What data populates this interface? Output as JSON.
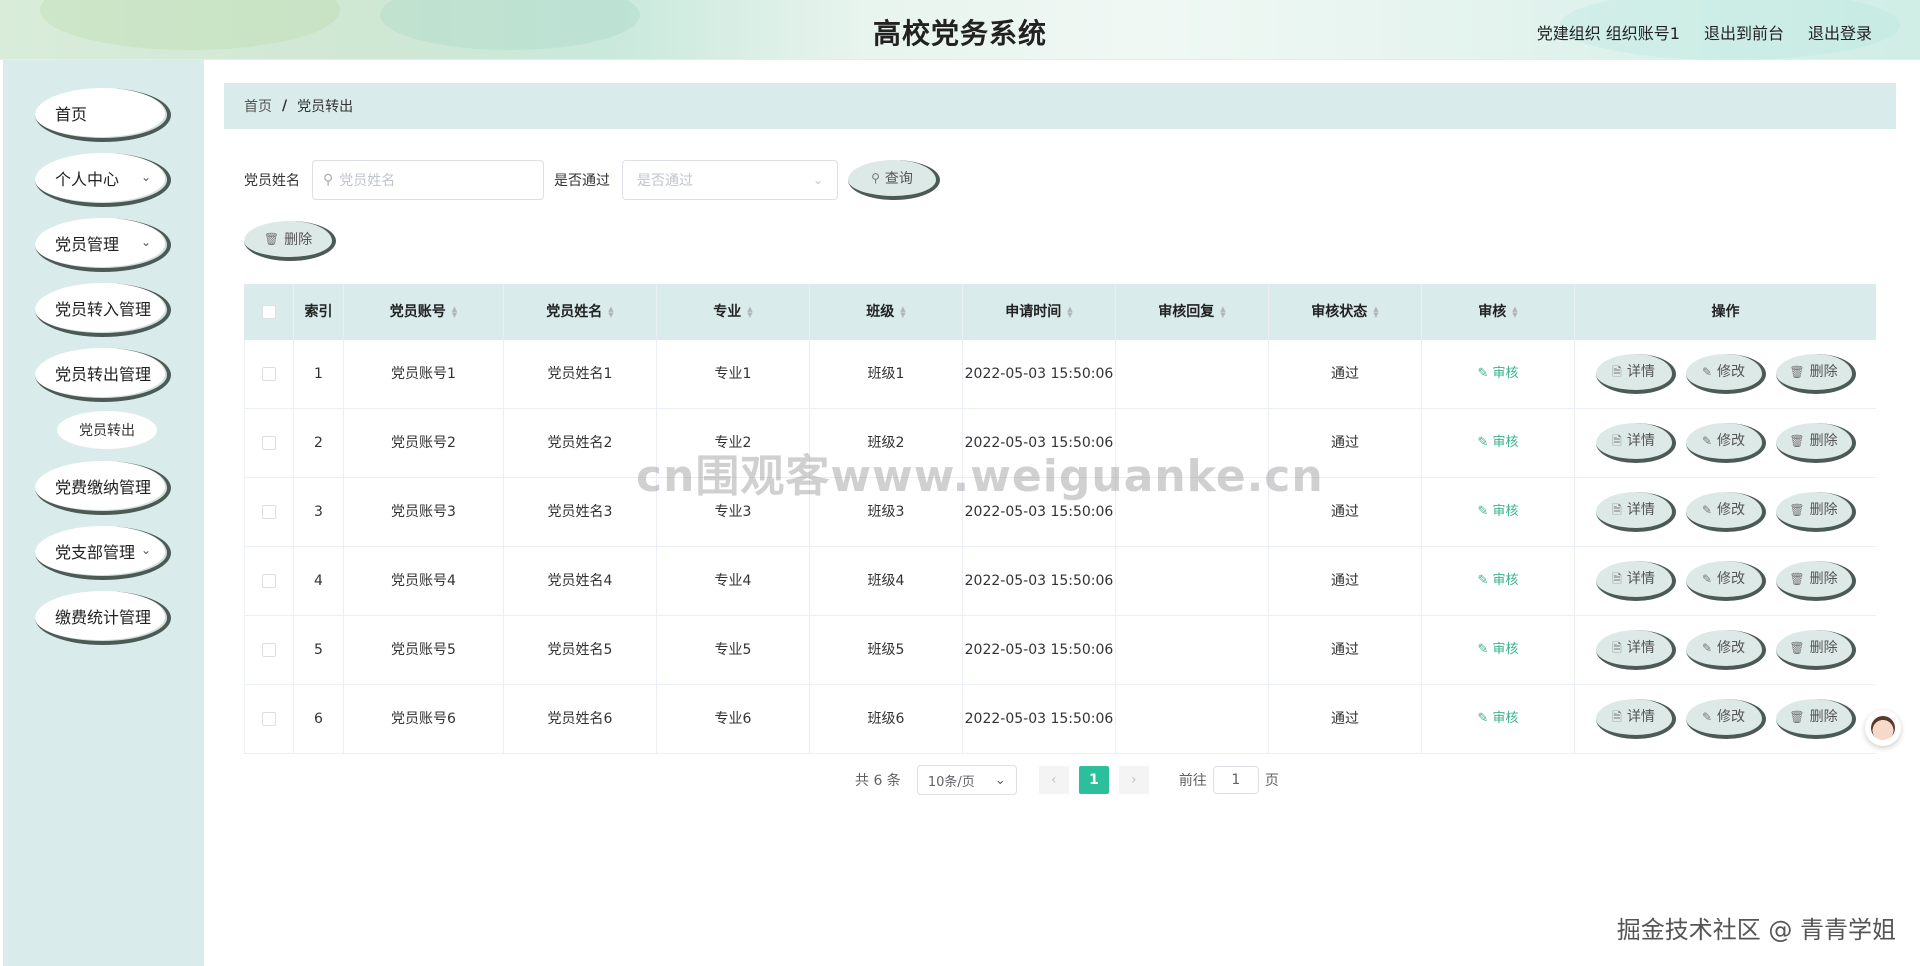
{
  "header": {
    "title": "高校党务系统",
    "user": "党建组织 组织账号1",
    "to_front": "退出到前台",
    "logout": "退出登录"
  },
  "sidebar": {
    "items": [
      {
        "label": "首页",
        "has_arrow": false
      },
      {
        "label": "个人中心",
        "has_arrow": true
      },
      {
        "label": "党员管理",
        "has_arrow": true
      },
      {
        "label": "党员转入管理",
        "has_arrow": false
      },
      {
        "label": "党员转出管理",
        "has_arrow": false
      },
      {
        "label": "党费缴纳管理",
        "has_arrow": false
      },
      {
        "label": "党支部管理",
        "has_arrow": true
      },
      {
        "label": "缴费统计管理",
        "has_arrow": false
      }
    ],
    "subitem": "党员转出"
  },
  "breadcrumb": {
    "home": "首页",
    "separator": "/",
    "current": "党员转出"
  },
  "search": {
    "name_label": "党员姓名",
    "name_placeholder": "党员姓名",
    "pass_label": "是否通过",
    "pass_placeholder": "是否通过",
    "query_button": "查询",
    "delete_button": "删除"
  },
  "table": {
    "headers": [
      "索引",
      "党员账号",
      "党员姓名",
      "专业",
      "班级",
      "申请时间",
      "审核回复",
      "审核状态",
      "审核",
      "操作"
    ],
    "rows": [
      {
        "index": "1",
        "account": "党员账号1",
        "name": "党员姓名1",
        "major": "专业1",
        "class": "班级1",
        "time": "2022-05-03 15:50:06",
        "reply": "",
        "status": "通过"
      },
      {
        "index": "2",
        "account": "党员账号2",
        "name": "党员姓名2",
        "major": "专业2",
        "class": "班级2",
        "time": "2022-05-03 15:50:06",
        "reply": "",
        "status": "通过"
      },
      {
        "index": "3",
        "account": "党员账号3",
        "name": "党员姓名3",
        "major": "专业3",
        "class": "班级3",
        "time": "2022-05-03 15:50:06",
        "reply": "",
        "status": "通过"
      },
      {
        "index": "4",
        "account": "党员账号4",
        "name": "党员姓名4",
        "major": "专业4",
        "class": "班级4",
        "time": "2022-05-03 15:50:06",
        "reply": "",
        "status": "通过"
      },
      {
        "index": "5",
        "account": "党员账号5",
        "name": "党员姓名5",
        "major": "专业5",
        "class": "班级5",
        "time": "2022-05-03 15:50:06",
        "reply": "",
        "status": "通过"
      },
      {
        "index": "6",
        "account": "党员账号6",
        "name": "党员姓名6",
        "major": "专业6",
        "class": "班级6",
        "time": "2022-05-03 15:50:06",
        "reply": "",
        "status": "通过"
      }
    ],
    "audit_label": "审核",
    "detail_label": "详情",
    "edit_label": "修改",
    "delete_label": "删除"
  },
  "pagination": {
    "total": "共 6 条",
    "page_size": "10条/页",
    "current_page": "1",
    "goto_prefix": "前往",
    "goto_value": "1",
    "goto_suffix": "页"
  },
  "watermark": "cn围观客www.weiguanke.cn",
  "footer_mark": "掘金技术社区 @ 青青学姐",
  "colors": {
    "accent": "#2bc09b",
    "panel_bg": "#d9ebea",
    "button_bg": "#dce9e7",
    "audit_link": "#3bb38f"
  },
  "icons": {
    "search": "search-icon",
    "trash": "trash-icon",
    "doc": "document-icon",
    "edit": "edit-icon",
    "chevron": "chevron-down-icon"
  }
}
